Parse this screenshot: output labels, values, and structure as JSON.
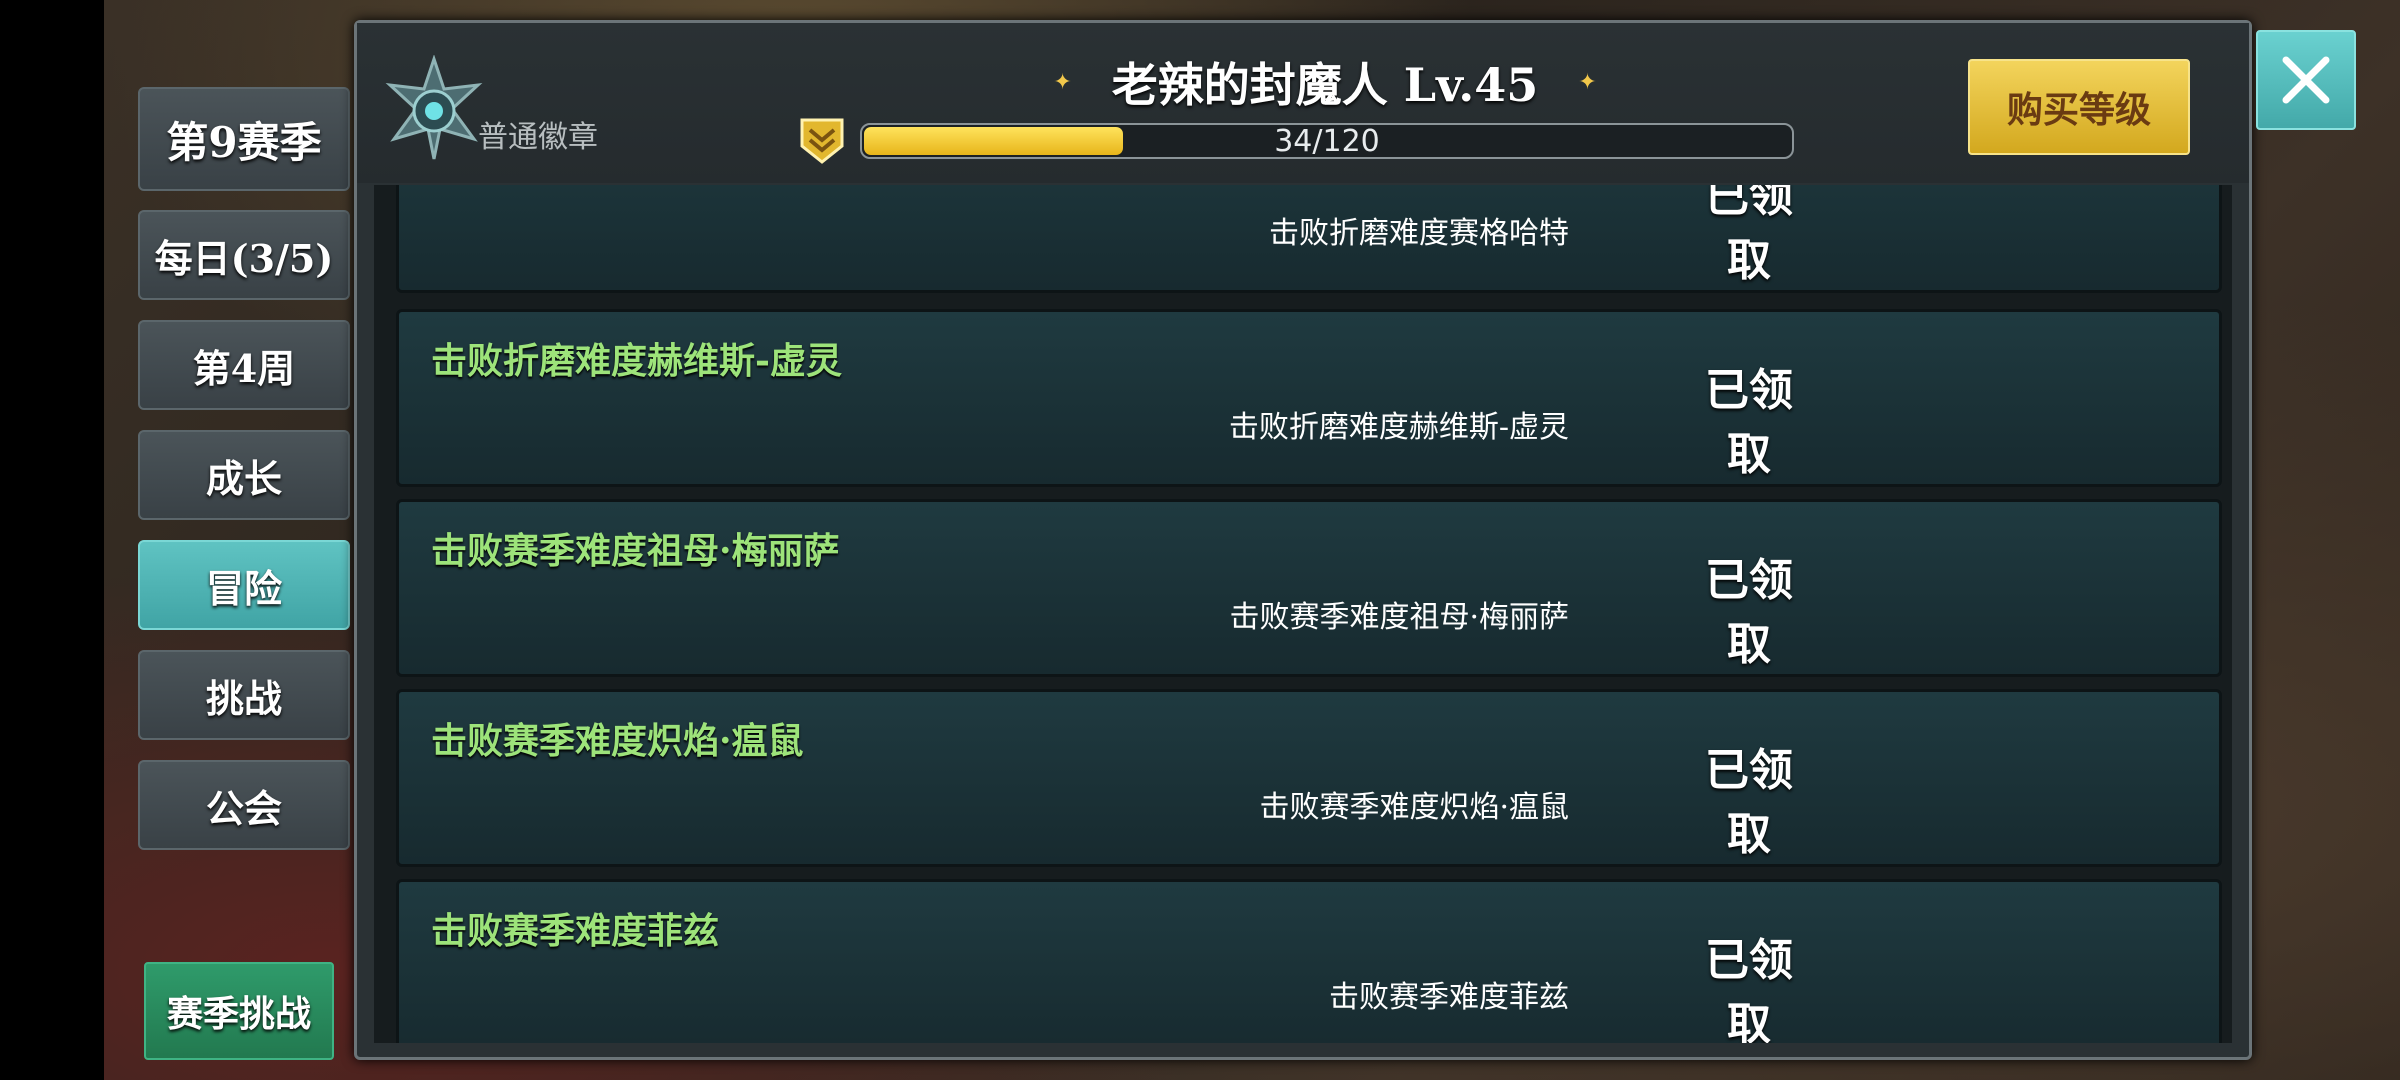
{
  "sidebar": {
    "season_label": "第9赛季",
    "tabs": [
      {
        "label": "每日(3/5)"
      },
      {
        "label": "第4周"
      },
      {
        "label": "成长"
      },
      {
        "label": "冒险"
      },
      {
        "label": "挑战"
      },
      {
        "label": "公会"
      }
    ],
    "active_tab": "冒险",
    "season_challenge_label": "赛季挑战"
  },
  "header": {
    "badge_label": "普通徽章",
    "title": "老辣的封魔人 Lv.45",
    "progress_text": "34/120",
    "progress_fraction": 0.2833,
    "buy_button_label": "购买等级"
  },
  "quests": [
    {
      "title": "",
      "desc": "击败折磨难度赛格哈特",
      "status": "已领取"
    },
    {
      "title": "击败折磨难度赫维斯-虚灵",
      "desc": "击败折磨难度赫维斯-虚灵",
      "status": "已领取"
    },
    {
      "title": "击败赛季难度祖母·梅丽萨",
      "desc": "击败赛季难度祖母·梅丽萨",
      "status": "已领取"
    },
    {
      "title": "击败赛季难度炽焰·瘟鼠",
      "desc": "击败赛季难度炽焰·瘟鼠",
      "status": "已领取"
    },
    {
      "title": "击败赛季难度菲兹",
      "desc": "击败赛季难度菲兹",
      "status": "已领取"
    }
  ],
  "colors": {
    "accent_teal": "#4fb5b5",
    "quest_title_green": "#9de37a",
    "gold": "#e7b51a"
  }
}
